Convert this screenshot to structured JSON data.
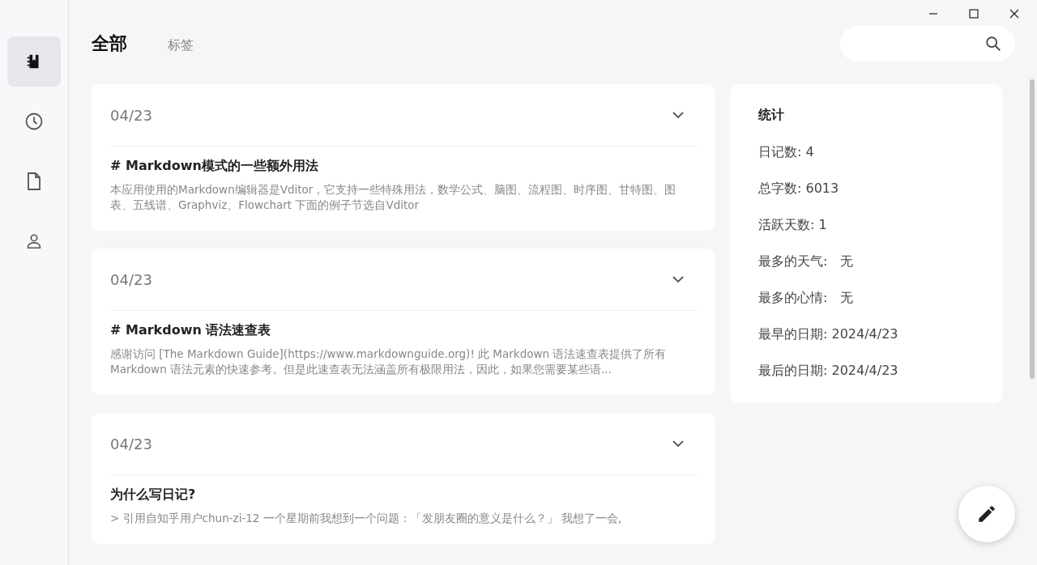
{
  "sidebar": {
    "items": [
      {
        "kind": "notebook",
        "selected": true
      },
      {
        "kind": "clock",
        "selected": false
      },
      {
        "kind": "file",
        "selected": false
      },
      {
        "kind": "person",
        "selected": false
      }
    ]
  },
  "tabs": [
    {
      "label": "全部",
      "selected": true
    },
    {
      "label": "标签",
      "selected": false
    }
  ],
  "entries": [
    {
      "date": "04/23",
      "title": "# Markdown模式的一些额外用法",
      "excerpt": "本应用使用的Markdown编辑器是Vditor，它支持一些特殊用法，数学公式、脑图、流程图、时序图、甘特图、图表、五线谱、Graphviz、Flowchart 下面的例子节选自Vditor"
    },
    {
      "date": "04/23",
      "title": "# Markdown 语法速查表",
      "excerpt": "感谢访问 [The Markdown Guide](https://www.markdownguide.org)! 此 Markdown 语法速查表提供了所有 Markdown 语法元素的快速参考。但是此速查表无法涵盖所有极限用法，因此，如果您需要某些语..."
    },
    {
      "date": "04/23",
      "title": "为什么写日记?",
      "excerpt": "> 引用自知乎用户chun-zi-12 一个星期前我想到一个问题：「发朋友圈的意义是什么？」 我想了一会,"
    }
  ],
  "stats": {
    "title": "统计",
    "rows": [
      "日记数: 4",
      "总字数: 6013",
      "活跃天数: 1",
      "最多的天气:　无",
      "最多的心情:　无",
      "最早的日期: 2024/4/23",
      "最后的日期: 2024/4/23"
    ]
  }
}
